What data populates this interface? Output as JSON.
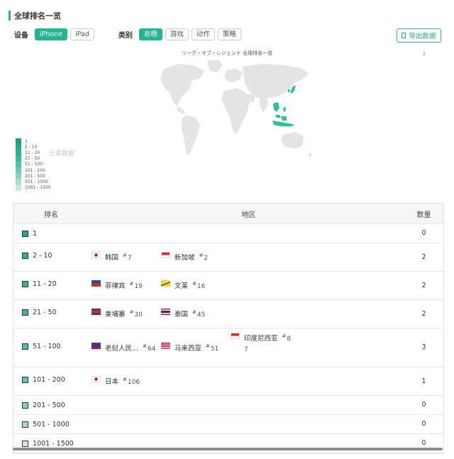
{
  "header": {
    "title": "全球排名一览"
  },
  "filters": {
    "device_label": "设备",
    "devices": [
      {
        "label": "iPhone",
        "active": true
      },
      {
        "label": "iPad",
        "active": false
      }
    ],
    "category_label": "类别",
    "categories": [
      {
        "label": "总榜",
        "active": true
      },
      {
        "label": "游戏",
        "active": false
      },
      {
        "label": "动作",
        "active": false
      },
      {
        "label": "策略",
        "active": false
      }
    ]
  },
  "export_label": "导出数据",
  "map": {
    "title": "リーグ・オブ・レジェンド 全球排名一览",
    "watermark": "七麦数据",
    "legend": [
      "1",
      "2 - 10",
      "11 - 20",
      "21 - 50",
      "51 - 100",
      "101 - 200",
      "201 - 500",
      "501 - 1000",
      "1001 - 1500"
    ],
    "legend_colors": [
      "#1f9e80",
      "#27a886",
      "#2db08e",
      "#3bb999",
      "#52c2a5",
      "#6dcbb3",
      "#8ad6c1",
      "#a9e1d1",
      "#c9ece2"
    ]
  },
  "table": {
    "headers": {
      "rank": "排名",
      "region": "地区",
      "count": "数量"
    },
    "rows": [
      {
        "rank": "1",
        "count": "0",
        "color": "#25a585",
        "countries": []
      },
      {
        "rank": "2 - 10",
        "count": "2",
        "color": "#2eb08e",
        "countries": [
          {
            "name": "韩国",
            "rank": "7",
            "flag": "kr"
          },
          {
            "name": "新加坡",
            "rank": "2",
            "flag": "sg"
          }
        ]
      },
      {
        "rank": "11 - 20",
        "count": "2",
        "color": "#33b491",
        "countries": [
          {
            "name": "菲律宾",
            "rank": "19",
            "flag": "ph"
          },
          {
            "name": "文莱",
            "rank": "16",
            "flag": "bn"
          }
        ]
      },
      {
        "rank": "21 - 50",
        "count": "2",
        "color": "#3bb999",
        "countries": [
          {
            "name": "柬埔寨",
            "rank": "30",
            "flag": "kh"
          },
          {
            "name": "泰国",
            "rank": "45",
            "flag": "th"
          }
        ]
      },
      {
        "rank": "51 - 100",
        "count": "3",
        "color": "#4cc0a2",
        "countries": [
          {
            "name": "老挝人民...",
            "rank": "64",
            "flag": "la"
          },
          {
            "name": "马来西亚",
            "rank": "51",
            "flag": "my"
          },
          {
            "name": "印度尼西亚",
            "rank": "8",
            "rank_cont": "7",
            "flag": "id"
          }
        ]
      },
      {
        "rank": "101 - 200",
        "count": "1",
        "color": "#5fc8ad",
        "countries": [
          {
            "name": "日本",
            "rank": "106",
            "flag": "jp"
          }
        ]
      },
      {
        "rank": "201 - 500",
        "count": "0",
        "color": "#7ed2bc",
        "countries": []
      },
      {
        "rank": "501 - 1000",
        "count": "0",
        "color": "#a2dccb",
        "countries": []
      },
      {
        "rank": "1001 - 1500",
        "count": "0",
        "color": "#c6eadf",
        "countries": []
      }
    ]
  }
}
